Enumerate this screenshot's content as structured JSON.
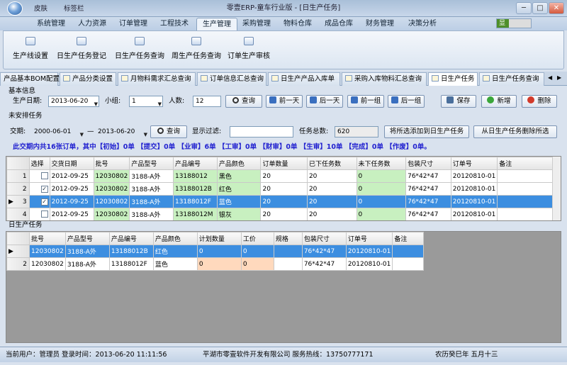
{
  "app": {
    "title": "零壹ERP-童车行业版 - [日生产任务]",
    "quick_skin": "皮肤",
    "quick_tabs": "标签栏",
    "skin_badge": "显"
  },
  "window_controls": {
    "min": "─",
    "max": "□",
    "close": "✕"
  },
  "menu": [
    "系统管理",
    "人力资源",
    "订单管理",
    "工程技术",
    "生产管理",
    "采购管理",
    "物料仓库",
    "成品仓库",
    "财务管理",
    "决策分析"
  ],
  "menu_active": "生产管理",
  "ribbon": [
    "生产线设置",
    "日生产任务登记",
    "日生产任务查询",
    "周生产任务查询",
    "订单生产审核"
  ],
  "doc_tabs": [
    "产品基本BOM配置",
    "产品分类设置",
    "月物料需求汇总查询",
    "订单信息汇总查询",
    "日生产产品入库单",
    "采购入库物料汇总查询",
    "日生产任务",
    "日生产任务查询"
  ],
  "doc_tab_active": "日生产任务",
  "basic": {
    "section": "基本信息",
    "date_label": "生产日期:",
    "date": "2013-06-20",
    "group_label": "小组:",
    "group": "1",
    "count_label": "人数:",
    "count": "12",
    "query": "查询",
    "prev_day": "前一天",
    "next_day": "后一天",
    "prev_group": "前一组",
    "next_group": "后一组",
    "save": "保存",
    "add": "新增",
    "delete": "删除"
  },
  "unarranged": {
    "section": "未安排任务",
    "period_label": "交期:",
    "from": "2000-06-01",
    "dash": "—",
    "to": "2013-06-20",
    "query": "查询",
    "filter_label": "显示过滤:",
    "filter_value": "",
    "total_label": "任务总数:",
    "total": "620",
    "add_selected": "将所选添加到日生产任务",
    "remove_selected": "从日生产任务删除所选"
  },
  "summary": "此交期内共16张订单，其中【初始】0单 【提交】0单 【业审】6单 【工审】0单 【财审】0单 【生审】10单 【完成】0单 【作废】0单。",
  "top_grid": {
    "headers": [
      "选择",
      "交货日期",
      "批号",
      "产品型号",
      "产品编号",
      "产品颜色",
      "订单数量",
      "已下任务数",
      "未下任务数",
      "包装尺寸",
      "订单号",
      "备注"
    ],
    "rows": [
      {
        "n": "1",
        "checked": false,
        "date": "2012-09-25",
        "batch": "12030802",
        "model": "3188-A外",
        "code": "13188012",
        "color": "黑色",
        "qty": "20",
        "done": "20",
        "left": "0",
        "pack": "76*42*47",
        "order": "20120810-01",
        "note": ""
      },
      {
        "n": "2",
        "checked": true,
        "date": "2012-09-25",
        "batch": "12030802",
        "model": "3188-A外",
        "code": "13188012B",
        "color": "红色",
        "qty": "20",
        "done": "20",
        "left": "0",
        "pack": "76*42*47",
        "order": "20120810-01",
        "note": ""
      },
      {
        "n": "3",
        "checked": true,
        "date": "2012-09-25",
        "batch": "12030802",
        "model": "3188-A外",
        "code": "13188012F",
        "color": "蓝色",
        "qty": "20",
        "done": "20",
        "left": "0",
        "pack": "76*42*47",
        "order": "20120810-01",
        "note": ""
      },
      {
        "n": "4",
        "checked": false,
        "date": "2012-09-25",
        "batch": "12030802",
        "model": "3188-A外",
        "code": "13188012M",
        "color": "银灰",
        "qty": "20",
        "done": "20",
        "left": "0",
        "pack": "76*42*47",
        "order": "20120810-01",
        "note": ""
      }
    ],
    "selected_row": 3
  },
  "daily": {
    "section": "日生产任务",
    "headers": [
      "批号",
      "产品型号",
      "产品编号",
      "产品颜色",
      "计划数量",
      "工价",
      "规格",
      "包装尺寸",
      "订单号",
      "备注"
    ],
    "rows": [
      {
        "n": "",
        "batch": "12030802",
        "model": "3188-A外",
        "code": "13188012B",
        "color": "红色",
        "plan": "0",
        "price": "0",
        "spec": "",
        "pack": "76*42*47",
        "order": "20120810-01",
        "note": ""
      },
      {
        "n": "2",
        "batch": "12030802",
        "model": "3188-A外",
        "code": "13188012F",
        "color": "蓝色",
        "plan": "0",
        "price": "0",
        "spec": "",
        "pack": "76*42*47",
        "order": "20120810-01",
        "note": ""
      }
    ],
    "selected_row": 1
  },
  "status": {
    "user": "当前用户：管理员 登录时间：2013-06-20 11:11:56",
    "company": "平湖市零壹软件开发有限公司 服务热线：13750777171",
    "lunar": "农历癸巳年 五月十三"
  },
  "colors": {
    "selected_row": "#3c8ee0",
    "green_cell": "#c8f0c0",
    "peach_cell": "#ffd9bd",
    "summary_text": "#2323d0"
  }
}
